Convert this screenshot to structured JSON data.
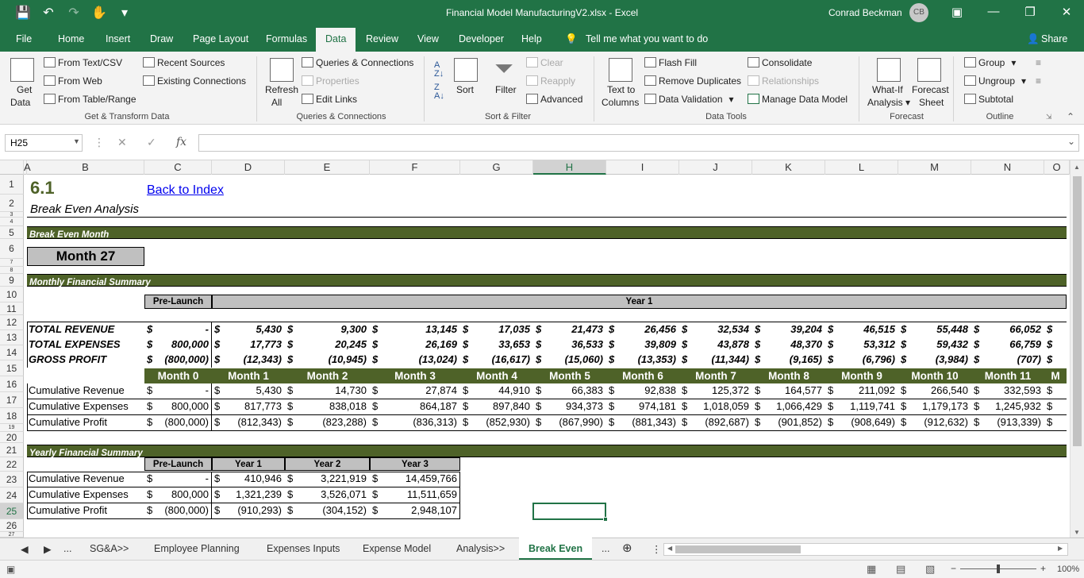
{
  "titlebar": {
    "doc_title": "Financial Model ManufacturingV2.xlsx - Excel",
    "user": "Conrad Beckman",
    "avatar": "CB"
  },
  "menu": {
    "tabs": [
      "File",
      "Home",
      "Insert",
      "Draw",
      "Page Layout",
      "Formulas",
      "Data",
      "Review",
      "View",
      "Developer",
      "Help"
    ],
    "active": "Data",
    "tell_me": "Tell me what you want to do",
    "share": "Share"
  },
  "ribbon": {
    "get_data": "Get",
    "get_data2": "Data",
    "from_text": "From Text/CSV",
    "from_web": "From Web",
    "from_table": "From Table/Range",
    "recent_sources": "Recent Sources",
    "existing_connections": "Existing Connections",
    "group_get": "Get & Transform Data",
    "refresh": "Refresh",
    "refresh2": "All",
    "queries_connections": "Queries & Connections",
    "properties": "Properties",
    "edit_links": "Edit Links",
    "group_queries": "Queries & Connections",
    "sort": "Sort",
    "filter": "Filter",
    "clear": "Clear",
    "reapply": "Reapply",
    "advanced": "Advanced",
    "group_sort": "Sort & Filter",
    "text_to": "Text to",
    "columns": "Columns",
    "flash_fill": "Flash Fill",
    "remove_duplicates": "Remove Duplicates",
    "data_validation": "Data Validation",
    "consolidate": "Consolidate",
    "relationships": "Relationships",
    "manage_model": "Manage Data Model",
    "group_tools": "Data Tools",
    "whatif": "What-If",
    "analysis": "Analysis",
    "forecast": "Forecast",
    "sheet": "Sheet",
    "group_forecast": "Forecast",
    "group_btn": "Group",
    "ungroup": "Ungroup",
    "subtotal": "Subtotal",
    "group_outline": "Outline"
  },
  "formula_bar": {
    "name_box": "H25",
    "fx": "fx",
    "formula": ""
  },
  "columns": [
    "A",
    "B",
    "C",
    "D",
    "E",
    "F",
    "G",
    "H",
    "I",
    "J",
    "K",
    "L",
    "M",
    "N",
    "O"
  ],
  "rows": [
    "1",
    "2",
    "3",
    "4",
    "5",
    "6",
    "7",
    "8",
    "9",
    "10",
    "11",
    "12",
    "13",
    "14",
    "15",
    "16",
    "17",
    "18",
    "19",
    "20",
    "21",
    "22",
    "23",
    "24",
    "25",
    "26",
    "27"
  ],
  "sheet": {
    "section_num": "6.1",
    "back_link": "Back to Index",
    "subtitle": "Break Even Analysis",
    "break_even_header": "Break Even Month",
    "break_even_value": "Month 27",
    "monthly_header": "Monthly Financial Summary",
    "prelaunch": "Pre-Launch",
    "year1": "Year 1",
    "summary_rows": [
      {
        "label": "TOTAL REVENUE",
        "cells": [
          "-",
          "5,430",
          "9,300",
          "13,145",
          "17,035",
          "21,473",
          "26,456",
          "32,534",
          "39,204",
          "46,515",
          "55,448",
          "66,052"
        ]
      },
      {
        "label": "TOTAL EXPENSES",
        "cells": [
          "800,000",
          "17,773",
          "20,245",
          "26,169",
          "33,653",
          "36,533",
          "39,809",
          "43,878",
          "48,370",
          "53,312",
          "59,432",
          "66,759"
        ]
      },
      {
        "label": "GROSS PROFIT",
        "cells": [
          "(800,000)",
          "(12,343)",
          "(10,945)",
          "(13,024)",
          "(16,617)",
          "(15,060)",
          "(13,353)",
          "(11,344)",
          "(9,165)",
          "(6,796)",
          "(3,984)",
          "(707)"
        ]
      }
    ],
    "months": [
      "Month 0",
      "Month 1",
      "Month 2",
      "Month 3",
      "Month 4",
      "Month 5",
      "Month 6",
      "Month 7",
      "Month 8",
      "Month 9",
      "Month 10",
      "Month 11",
      "M"
    ],
    "cumulative_rows": [
      {
        "label": "Cumulative Revenue",
        "cells": [
          "-",
          "5,430",
          "14,730",
          "27,874",
          "44,910",
          "66,383",
          "92,838",
          "125,372",
          "164,577",
          "211,092",
          "266,540",
          "332,593"
        ]
      },
      {
        "label": "Cumulative Expenses",
        "cells": [
          "800,000",
          "817,773",
          "838,018",
          "864,187",
          "897,840",
          "934,373",
          "974,181",
          "1,018,059",
          "1,066,429",
          "1,119,741",
          "1,179,173",
          "1,245,932"
        ]
      },
      {
        "label": "Cumulative Profit",
        "cells": [
          "(800,000)",
          "(812,343)",
          "(823,288)",
          "(836,313)",
          "(852,930)",
          "(867,990)",
          "(881,343)",
          "(892,687)",
          "(901,852)",
          "(908,649)",
          "(912,632)",
          "(913,339)"
        ]
      }
    ],
    "yearly_header": "Yearly Financial Summary",
    "yearly_cols": [
      "Pre-Launch",
      "Year 1",
      "Year 2",
      "Year 3"
    ],
    "yearly_rows": [
      {
        "label": "Cumulative Revenue",
        "cells": [
          "-",
          "410,946",
          "3,221,919",
          "14,459,766"
        ]
      },
      {
        "label": "Cumulative Expenses",
        "cells": [
          "800,000",
          "1,321,239",
          "3,526,071",
          "11,511,659"
        ]
      },
      {
        "label": "Cumulative Profit",
        "cells": [
          "(800,000)",
          "(910,293)",
          "(304,152)",
          "2,948,107"
        ]
      }
    ]
  },
  "sheet_tabs": {
    "ellipsis": "...",
    "tabs": [
      "SG&A>>",
      "Employee Planning",
      "Expenses Inputs",
      "Expense Model",
      "Analysis>>",
      "Break Even"
    ],
    "active": "Break Even",
    "ellipsis2": "..."
  },
  "statusbar": {
    "zoom": "100%"
  }
}
